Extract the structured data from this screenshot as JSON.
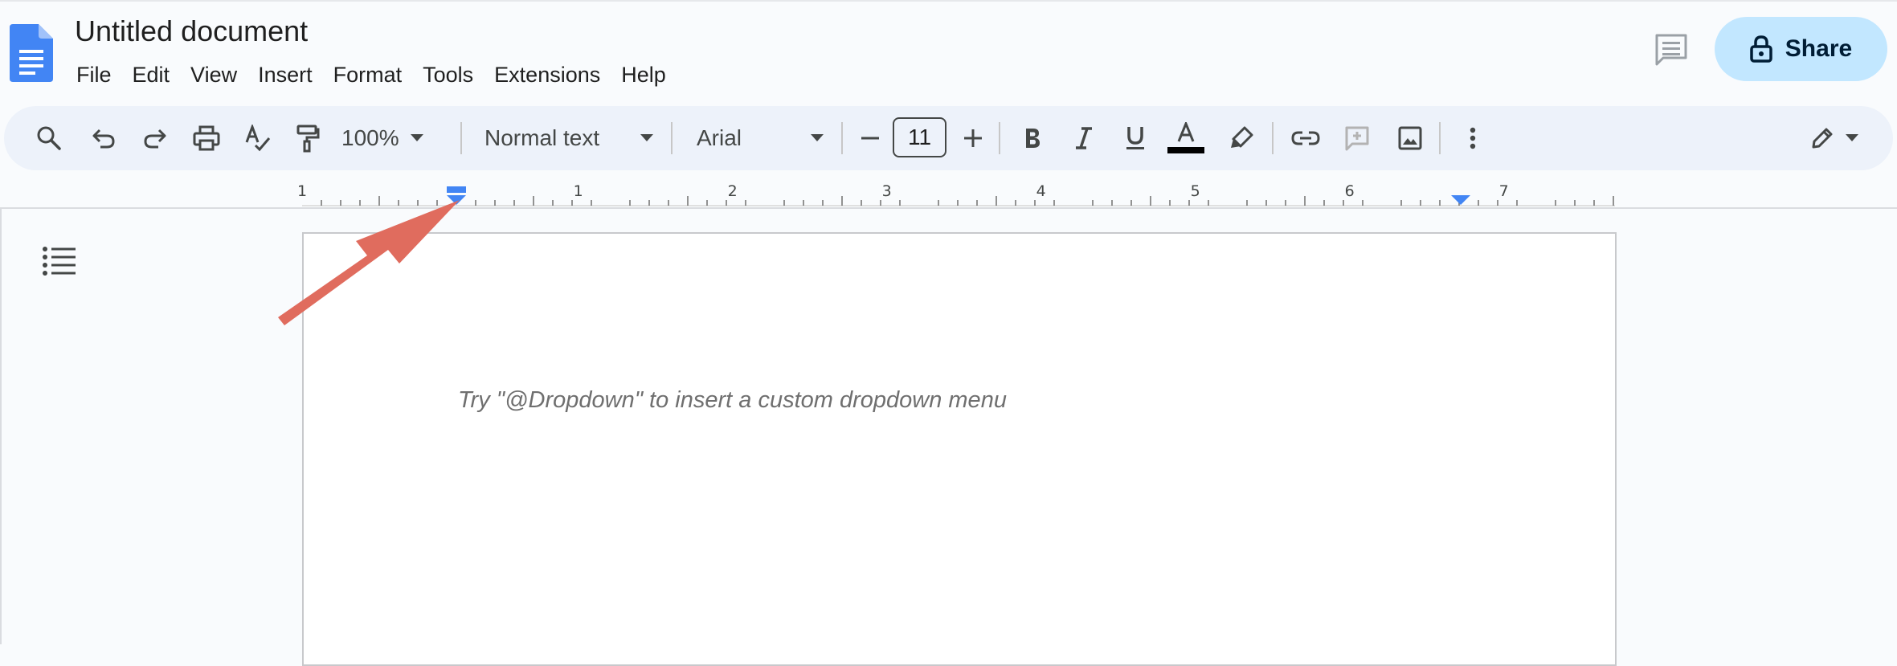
{
  "header": {
    "doc_title": "Untitled document",
    "menu": [
      "File",
      "Edit",
      "View",
      "Insert",
      "Format",
      "Tools",
      "Extensions",
      "Help"
    ],
    "share_label": "Share"
  },
  "toolbar": {
    "zoom": "100%",
    "style": "Normal text",
    "font": "Arial",
    "font_size": "11"
  },
  "ruler": {
    "labels": [
      "1",
      "1",
      "2",
      "3",
      "4",
      "5",
      "6",
      "7"
    ]
  },
  "document": {
    "placeholder": "Try \"@Dropdown\" to insert a custom dropdown menu"
  },
  "colors": {
    "accent": "#4285f4",
    "share_bg": "#c2e7ff",
    "toolbar_bg": "#edf2fa",
    "annotation_arrow": "#e06c5e"
  },
  "icons": [
    "docs-logo-icon",
    "comment-icon",
    "lock-icon",
    "search-icon",
    "undo-icon",
    "redo-icon",
    "print-icon",
    "spellcheck-icon",
    "paint-format-icon",
    "caret-down-icon",
    "minus-icon",
    "plus-icon",
    "bold-icon",
    "italic-icon",
    "underline-icon",
    "text-color-icon",
    "highlighter-icon",
    "link-icon",
    "add-comment-icon",
    "image-icon",
    "more-vert-icon",
    "edit-pencil-icon",
    "outline-list-icon",
    "indent-marker-icon"
  ]
}
